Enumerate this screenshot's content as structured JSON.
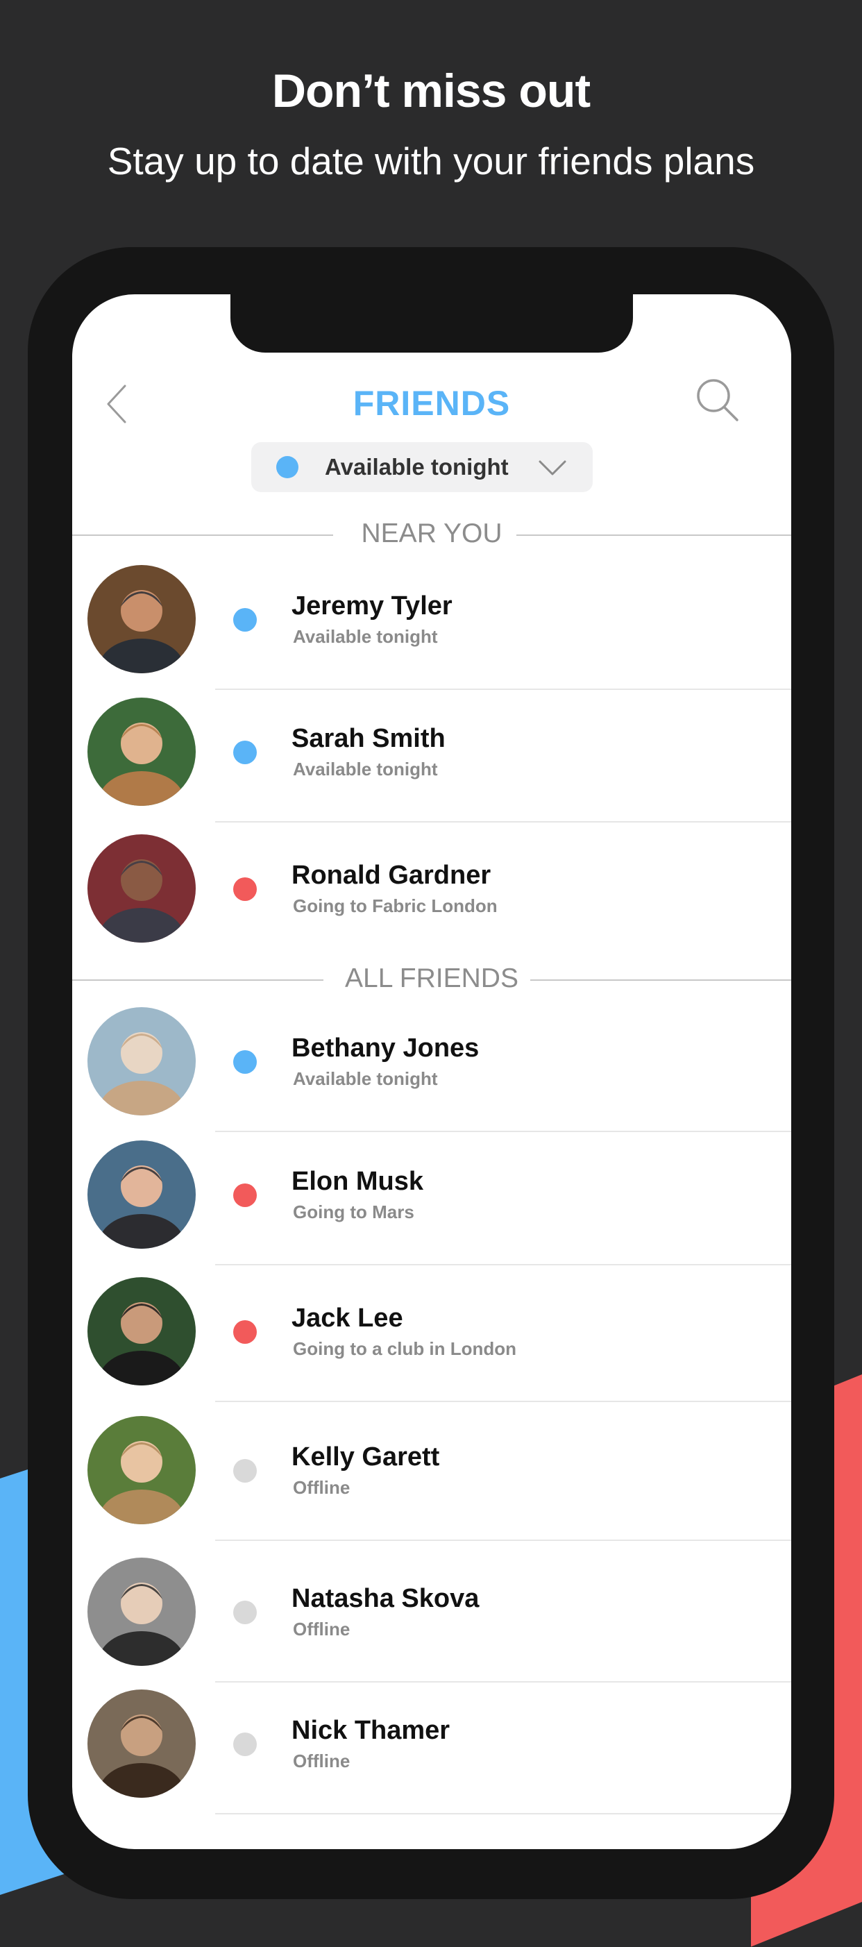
{
  "headline": "Don’t miss out",
  "subheadline": "Stay up to date with your friends plans",
  "colors": {
    "accent_blue": "#5ab4f7",
    "accent_red": "#f25a5a",
    "offline_gray": "#d9d9d9",
    "background": "#2b2b2c"
  },
  "nav": {
    "back_icon": "chevron-left-icon",
    "title": "FRIENDS",
    "search_icon": "search-icon"
  },
  "filter": {
    "label": "Available tonight",
    "status": "available",
    "chevron_icon": "chevron-down-icon"
  },
  "sections": {
    "near_you": "NEAR YOU",
    "all_friends": "ALL FRIENDS"
  },
  "friends_near": [
    {
      "name": "Jeremy Tyler",
      "status_text": "Available tonight",
      "status": "available"
    },
    {
      "name": "Sarah Smith",
      "status_text": "Available tonight",
      "status": "available"
    },
    {
      "name": "Ronald Gardner",
      "status_text": "Going to Fabric London",
      "status": "busy"
    }
  ],
  "friends_all": [
    {
      "name": "Bethany Jones",
      "status_text": "Available tonight",
      "status": "available"
    },
    {
      "name": "Elon Musk",
      "status_text": "Going to Mars",
      "status": "busy"
    },
    {
      "name": "Jack Lee",
      "status_text": "Going to a club in London",
      "status": "busy"
    },
    {
      "name": "Kelly Garett",
      "status_text": "Offline",
      "status": "offline"
    },
    {
      "name": "Natasha Skova",
      "status_text": "Offline",
      "status": "offline"
    },
    {
      "name": "Nick Thamer",
      "status_text": "Offline",
      "status": "offline"
    }
  ]
}
